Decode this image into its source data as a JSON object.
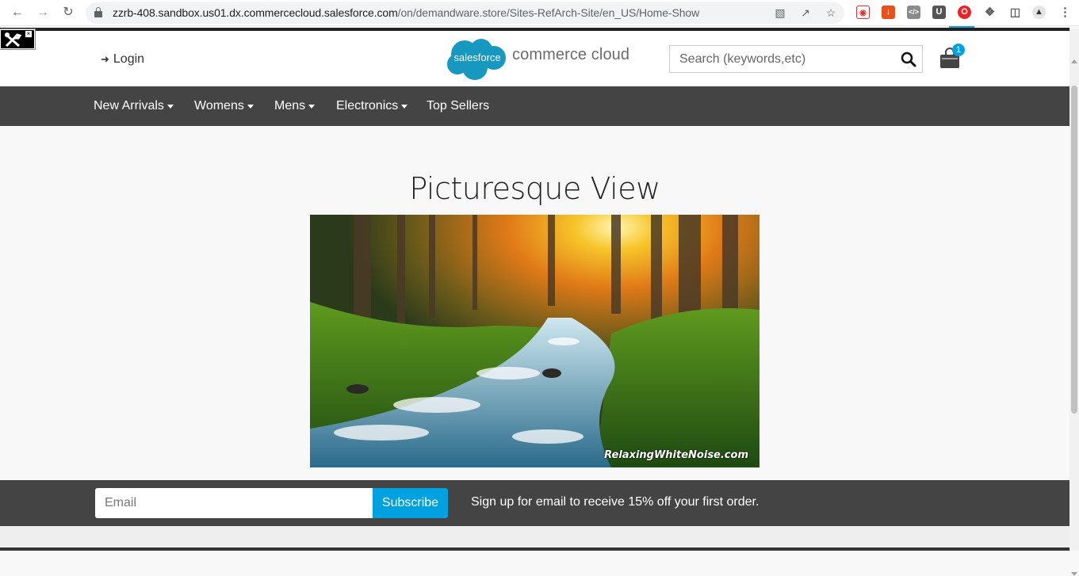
{
  "browser": {
    "url_host": "zzrb-408.sandbox.us01.dx.commercecloud.salesforce.com",
    "url_path": "/on/demandware.store/Sites-RefArch-Site/en_US/Home-Show"
  },
  "header": {
    "login_label": "Login",
    "logo_cloud_text": "salesforce",
    "logo_text": "commerce cloud",
    "search_placeholder": "Search (keywords,etc)",
    "cart_count": "1"
  },
  "nav": {
    "items": [
      {
        "label": "New Arrivals",
        "dropdown": true
      },
      {
        "label": "Womens",
        "dropdown": true
      },
      {
        "label": "Mens",
        "dropdown": true
      },
      {
        "label": "Electronics",
        "dropdown": true
      },
      {
        "label": "Top Sellers",
        "dropdown": false
      }
    ]
  },
  "hero": {
    "title": "Picturesque View",
    "watermark": "RelaxingWhiteNoise.com"
  },
  "signup": {
    "email_placeholder": "Email",
    "subscribe_label": "Subscribe",
    "promo_text": "Sign up for email to receive 15% off your first order."
  },
  "colors": {
    "accent": "#00a1e0",
    "nav_bg": "#444444",
    "salesforce_blue": "#1798c1"
  }
}
